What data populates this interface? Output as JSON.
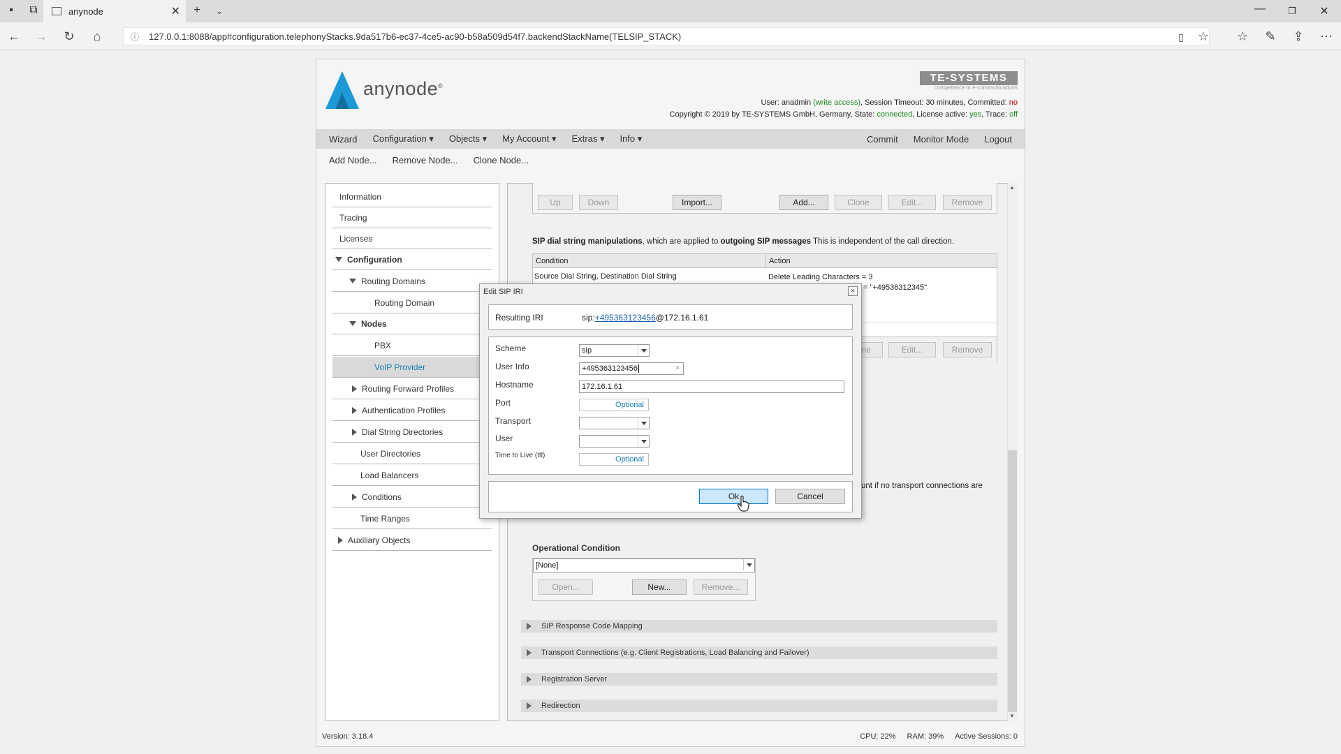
{
  "browser": {
    "tab_title": "anynode",
    "url": "127.0.0.1:8088/app#configuration.telephonyStacks.9da517b6-ec37-4ce5-ac90-b58a509d54f7.backendStackName(TELSIP_STACK)"
  },
  "header": {
    "logo_text": "anynode",
    "brand_logo": "TE-SYSTEMS",
    "brand_tagline": "competence in e-communications",
    "user_label": "User:",
    "user_name": "anadmin",
    "user_access": "(write access)",
    "session_text": ", Session Timeout: 30 minutes, Committed:",
    "committed_value": "no",
    "copyright": "Copyright © 2019 by TE-SYSTEMS GmbH, Germany, State:",
    "state_value": "connected",
    "license_label": ", License active:",
    "license_value": "yes",
    "trace_label": ", Trace:",
    "trace_value": "off"
  },
  "menu": {
    "left": [
      "Wizard",
      "Configuration",
      "Objects",
      "My Account",
      "Extras",
      "Info"
    ],
    "right": [
      "Commit",
      "Monitor Mode",
      "Logout"
    ],
    "sub": [
      "Add Node...",
      "Remove Node...",
      "Clone Node..."
    ]
  },
  "sidebar": {
    "items": [
      "Information",
      "Tracing",
      "Licenses",
      "Configuration",
      "Routing Domains",
      "Routing Domain",
      "Nodes",
      "PBX",
      "VoIP Provider",
      "Routing Forward Profiles",
      "Authentication Profiles",
      "Dial String Directories",
      "User Directories",
      "Load Balancers",
      "Conditions",
      "Time Ranges",
      "Auxiliary Objects"
    ]
  },
  "main": {
    "top_buttons": [
      "Up",
      "Down",
      "Import...",
      "Add...",
      "Clone",
      "Edit...",
      "Remove"
    ],
    "sip_heading_bold": "SIP dial string manipulations",
    "sip_heading_mid": ", which are applied to ",
    "sip_heading_bold2": "outgoing SIP messages",
    "sip_heading_end": " This is independent of the call direction.",
    "table_headers": [
      "Condition",
      "Action"
    ],
    "table_row_condition": "Source Dial String, Destination Dial String",
    "table_row_action1": "Delete Leading Characters = 3",
    "table_row_action2": "= \"+49536312345\"",
    "lower_buttons": [
      "ne",
      "Edit...",
      "Remove"
    ],
    "partial_text": "unt if no transport connections are",
    "op_condition_label": "Operational Condition",
    "op_condition_value": "[None]",
    "op_buttons": [
      "Open...",
      "New...",
      "Remove..."
    ],
    "sections": [
      "SIP Response Code Mapping",
      "Transport Connections (e.g. Client Registrations, Load Balancing and Failover)",
      "Registration Server",
      "Redirection"
    ]
  },
  "dialog": {
    "title": "Edit SIP IRI",
    "close": "×",
    "resulting_label": "Resulting IRI",
    "iri_prefix": "sip:",
    "iri_user": "+495363123456",
    "iri_host": "@172.16.1.61",
    "labels": [
      "Scheme",
      "User Info",
      "Hostname",
      "Port",
      "Transport",
      "User",
      "Time to Live (ttl)"
    ],
    "scheme_value": "sip",
    "userinfo_value": "+495363123456",
    "userinfo_clear": "×",
    "hostname_value": "172.16.1.61",
    "port_placeholder": "Optional",
    "transport_value": "",
    "user_value": "",
    "ttl_placeholder": "Optional",
    "ok_label": "Ok",
    "cancel_label": "Cancel"
  },
  "footer": {
    "version": "Version: 3.18.4",
    "cpu": "CPU: 22%",
    "ram": "RAM: 39%",
    "sessions": "Active Sessions: 0"
  },
  "colors": {
    "accent": "#1a7fb5",
    "ok_button": "#cce8ff",
    "ok_border": "#0078d7",
    "logo_blue": "#1b9ad6"
  }
}
